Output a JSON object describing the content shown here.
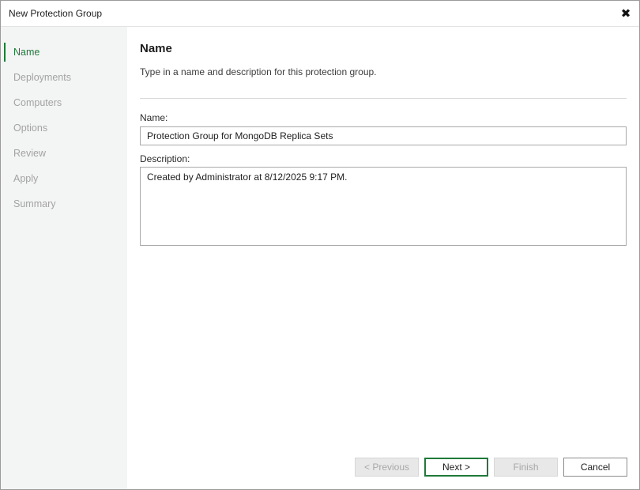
{
  "window": {
    "title": "New Protection Group",
    "close_glyph": "✖"
  },
  "sidebar": {
    "steps": [
      {
        "label": "Name",
        "active": true
      },
      {
        "label": "Deployments",
        "active": false
      },
      {
        "label": "Computers",
        "active": false
      },
      {
        "label": "Options",
        "active": false
      },
      {
        "label": "Review",
        "active": false
      },
      {
        "label": "Apply",
        "active": false
      },
      {
        "label": "Summary",
        "active": false
      }
    ]
  },
  "page": {
    "title": "Name",
    "subtitle": "Type in a name and description for this protection group."
  },
  "form": {
    "name_label": "Name:",
    "name_value": "Protection Group for MongoDB Replica Sets",
    "description_label": "Description:",
    "description_value": "Created by Administrator at 8/12/2025 9:17 PM."
  },
  "buttons": {
    "previous": "< Previous",
    "next": "Next >",
    "finish": "Finish",
    "cancel": "Cancel"
  },
  "colors": {
    "accent": "#1f7a3a",
    "sidebar_bg": "#f3f4f4",
    "inactive_step": "#a3a3a3"
  }
}
